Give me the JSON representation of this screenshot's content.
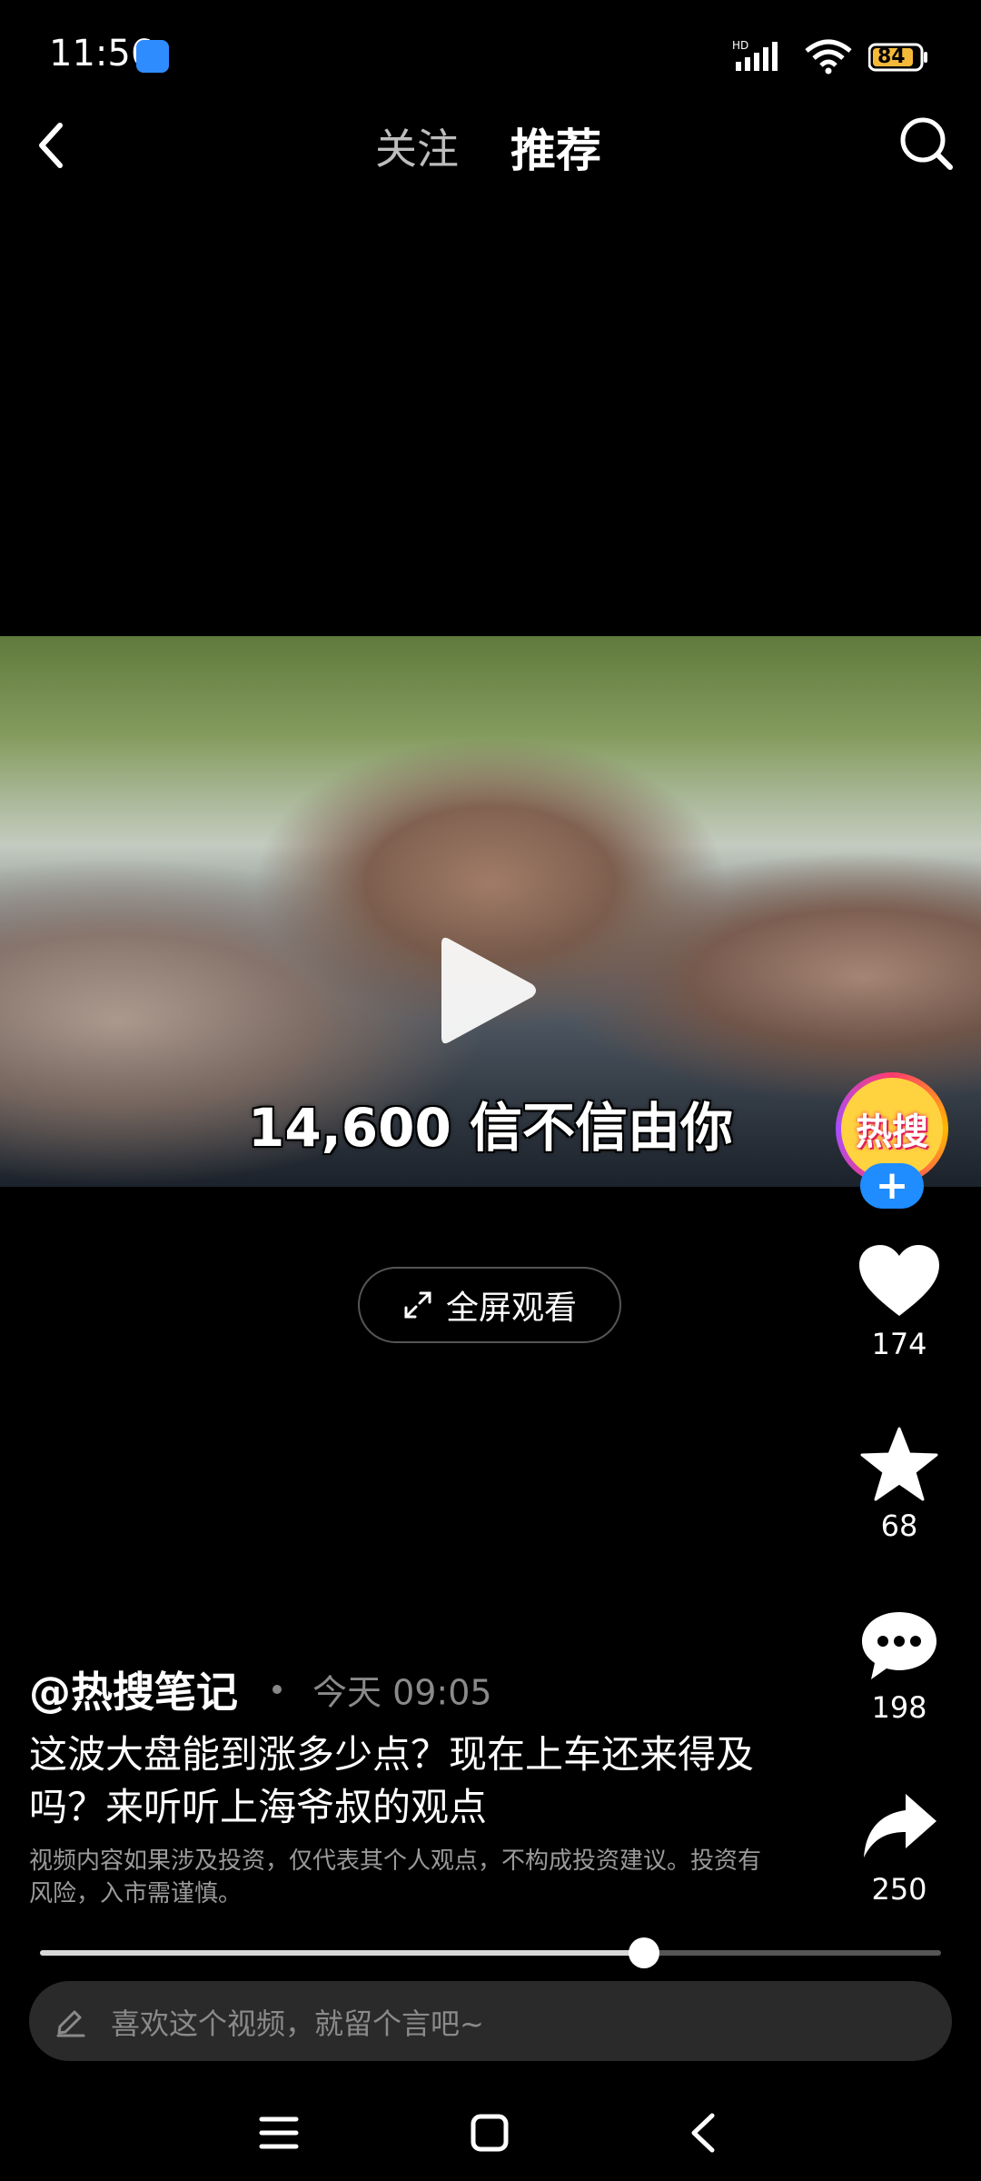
{
  "status_bar": {
    "time": "11:56",
    "network_label": "HD",
    "battery": "84"
  },
  "top_nav": {
    "tabs": [
      {
        "label": "关注",
        "active": false
      },
      {
        "label": "推荐",
        "active": true
      }
    ]
  },
  "video": {
    "caption": "14,600 信不信由你",
    "playback_progress": 0.67
  },
  "creator_badge": {
    "text": "热搜",
    "follow_symbol": "+"
  },
  "fullscreen_button": {
    "label": "全屏观看"
  },
  "actions": {
    "likes": "174",
    "favorites": "68",
    "comments": "198",
    "shares": "250"
  },
  "post": {
    "author": "@热搜笔记",
    "time": "今天 09:05",
    "title": "这波大盘能到涨多少点？现在上车还来得及吗？来听听上海爷叔的观点",
    "disclaimer": "视频内容如果涉及投资，仅代表其个人观点，不构成投资建议。投资有风险，入市需谨慎。"
  },
  "comment_input": {
    "placeholder": "喜欢这个视频，就留个言吧~"
  },
  "colors": {
    "background": "#000000",
    "accent_blue": "#1f8cff",
    "battery_fill": "#f5b93a"
  },
  "icons": [
    "back-icon",
    "search-icon",
    "play-icon",
    "heart-icon",
    "star-icon",
    "comment-icon",
    "share-icon",
    "expand-icon",
    "pencil-icon",
    "menu-icon",
    "home-icon",
    "nav-back-icon"
  ]
}
